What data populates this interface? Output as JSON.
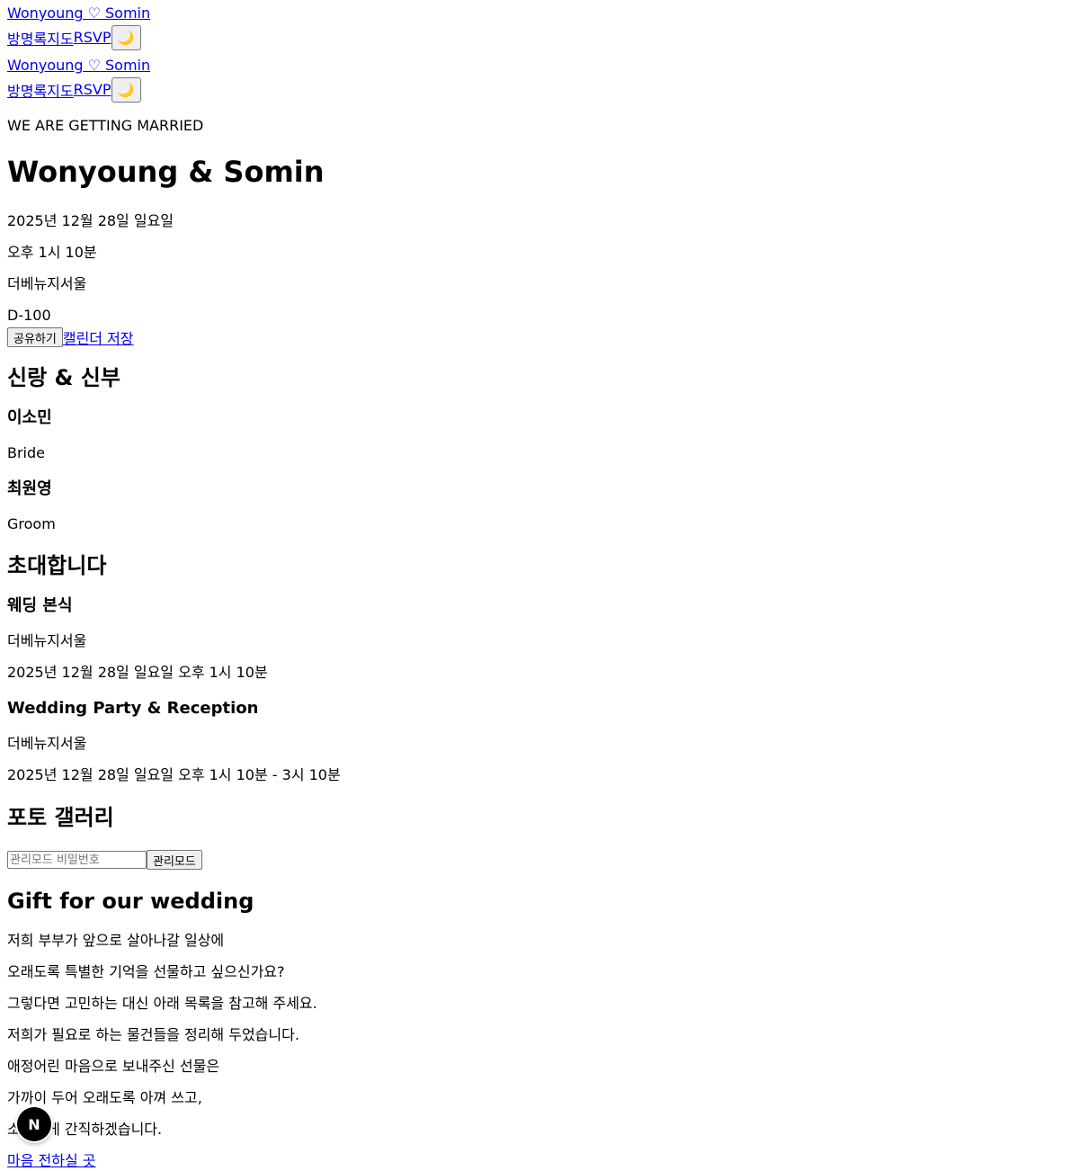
{
  "header": {
    "title": "Wonyoung ♡ Somin",
    "nav": [
      "방명록",
      "지도",
      "RSVP"
    ],
    "theme_icon": "🌙"
  },
  "hero": {
    "kicker": "WE ARE GETTING MARRIED",
    "title": "Wonyoung & Somin",
    "date": "2025년 12월 28일 일요일",
    "time": "오후 1시 10분",
    "venue": "더베뉴지서울",
    "dday": "D-100",
    "share_label": "공유하기",
    "calendar_label": "캘린더 저장"
  },
  "couple": {
    "heading": "신랑 & 신부",
    "bride_name": "이소민",
    "bride_role": "Bride",
    "groom_name": "최원영",
    "groom_role": "Groom"
  },
  "invite": {
    "heading": "초대합니다",
    "ceremony_title": "웨딩 본식",
    "ceremony_venue": "더베뉴지서울",
    "ceremony_time": "2025년 12월 28일 일요일 오후 1시 10분",
    "party_title": "Wedding Party & Reception",
    "party_venue": "더베뉴지서울",
    "party_time": "2025년 12월 28일 일요일 오후 1시 10분 - 3시 10분"
  },
  "gallery": {
    "heading": "포토 갤러리",
    "password_placeholder": "관리모드 비밀번호",
    "admin_label": "관리모드"
  },
  "gift": {
    "heading": "Gift for our wedding",
    "lines": [
      "저희 부부가 앞으로 살아나갈 일상에",
      "오래도록 특별한 기억을 선물하고 싶으신가요?",
      "그렇다면 고민하는 대신 아래 목록을 참고해 주세요.",
      "저희가 필요로 하는 물건들을 정리해 두었습니다.",
      "애정어린 마음으로 보내주신 선물은",
      "가까이 두어 오래도록 아껴 쓰고,",
      "소중하게 간직하겠습니다."
    ],
    "link_label": "마음 전하실 곳"
  },
  "dev_badge": {
    "label": "N"
  }
}
